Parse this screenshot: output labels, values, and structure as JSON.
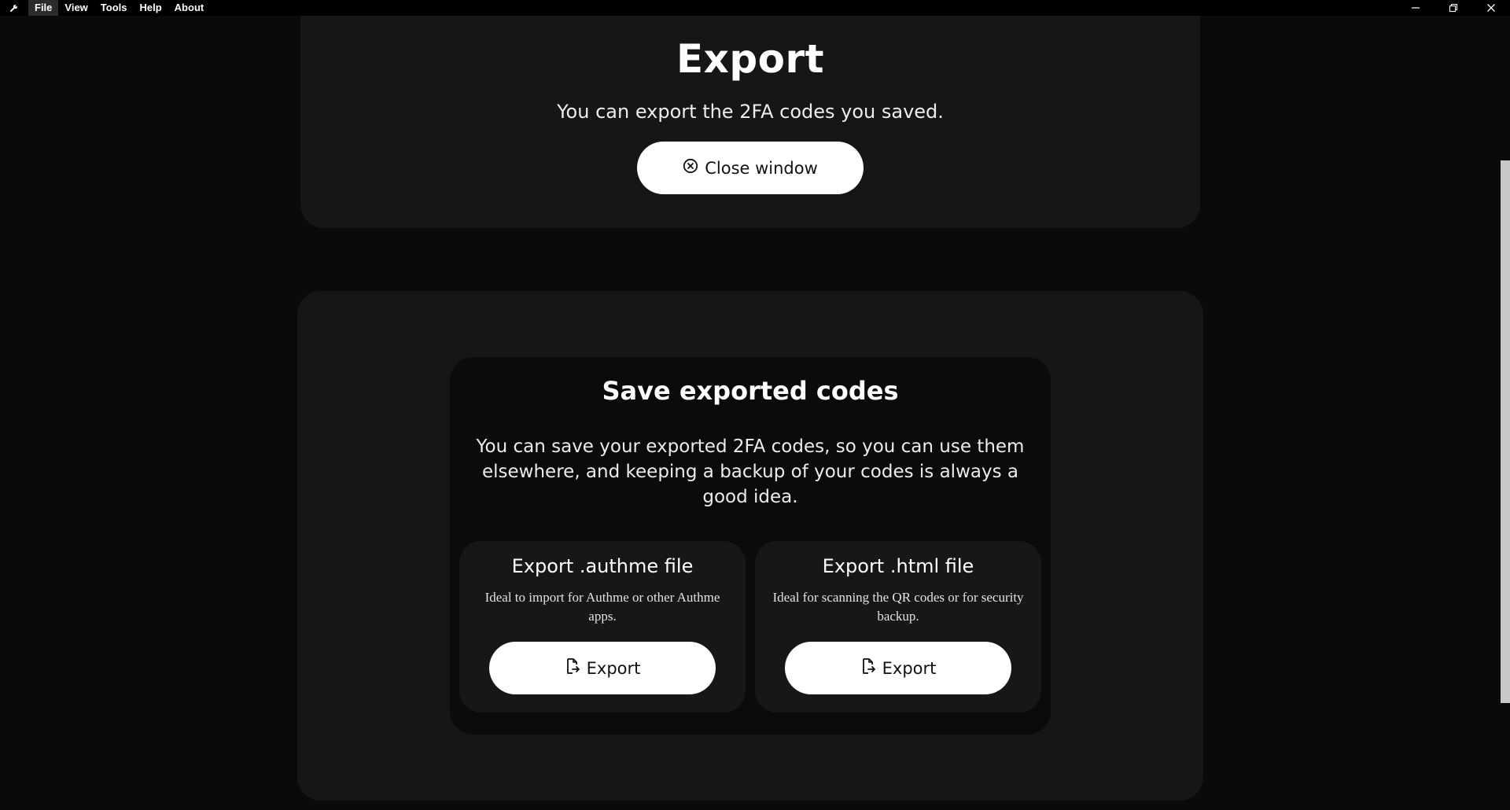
{
  "menu": {
    "items": [
      {
        "label": "File"
      },
      {
        "label": "View"
      },
      {
        "label": "Tools"
      },
      {
        "label": "Help"
      },
      {
        "label": "About"
      }
    ]
  },
  "header": {
    "title": "Export",
    "subtitle": "You can export the 2FA codes you saved.",
    "close_label": "Close window"
  },
  "save": {
    "title": "Save exported codes",
    "description": "You can save your exported 2FA codes, so you can use them elsewhere, and keeping a backup of your codes is always a good idea.",
    "options": [
      {
        "title": "Export .authme file",
        "description": "Ideal to import for Authme or other Authme apps.",
        "button_label": "Export"
      },
      {
        "title": "Export .html file",
        "description": "Ideal for scanning the QR codes or for security backup.",
        "button_label": "Export"
      }
    ]
  },
  "icons": {
    "app": "wrench-icon",
    "close": "x-circle-icon",
    "export": "file-export-icon",
    "minimize": "minimize-icon",
    "restore": "restore-icon",
    "window_close": "close-icon"
  },
  "colors": {
    "background": "#0a0a0a",
    "card": "#161616",
    "inner_card": "#0b0b0b",
    "button": "#ffffff",
    "button_text": "#111111"
  }
}
